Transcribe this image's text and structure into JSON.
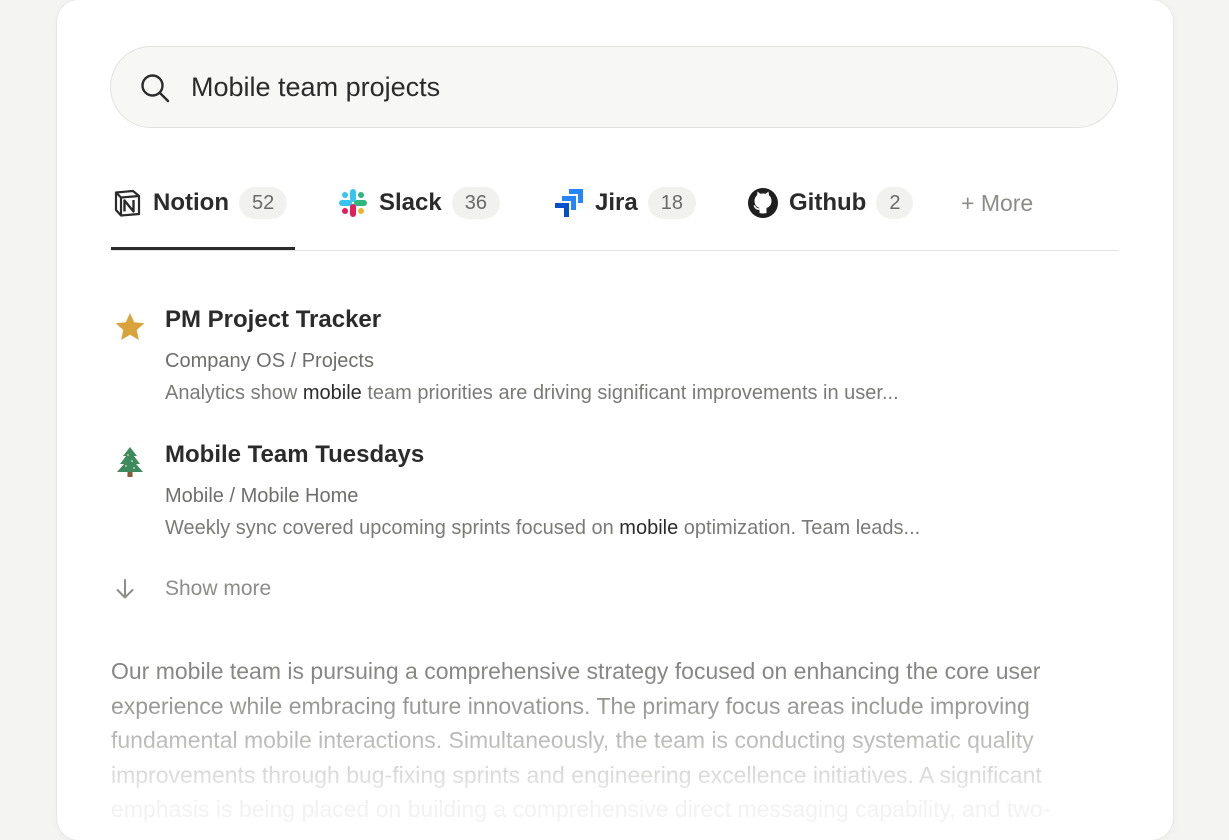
{
  "search": {
    "query": "Mobile team projects",
    "icon": "search-icon"
  },
  "tabs": [
    {
      "label": "Notion",
      "count": "52",
      "icon": "notion-icon",
      "active": true
    },
    {
      "label": "Slack",
      "count": "36",
      "icon": "slack-icon"
    },
    {
      "label": "Jira",
      "count": "18",
      "icon": "jira-icon"
    },
    {
      "label": "Github",
      "count": "2",
      "icon": "github-icon"
    }
  ],
  "more_label": "+ More",
  "results": [
    {
      "icon": "star-icon",
      "title": "PM Project Tracker",
      "path": "Company OS / Projects",
      "snippet_before": "Analytics show ",
      "snippet_highlight": "mobile",
      "snippet_after": " team priorities are driving significant improvements in user..."
    },
    {
      "icon": "tree-icon",
      "title": "Mobile Team Tuesdays",
      "path": "Mobile / Mobile Home",
      "snippet_before": "Weekly sync covered upcoming sprints focused on ",
      "snippet_highlight": "mobile",
      "snippet_after": " optimization. Team leads..."
    }
  ],
  "show_more_label": "Show more",
  "summary": "Our mobile team is pursuing a comprehensive strategy focused on enhancing the core user experience while embracing future innovations. The primary focus areas include improving fundamental mobile interactions. Simultaneously, the team is conducting systematic quality improvements through bug-fixing sprints and engineering excellence initiatives. A significant emphasis is being placed on building a comprehensive direct messaging capability, and two-",
  "colors": {
    "star": "#d9a23a",
    "tree": "#3f8a5c",
    "jira": "#2684ff",
    "text_primary": "#2b2b2b"
  }
}
